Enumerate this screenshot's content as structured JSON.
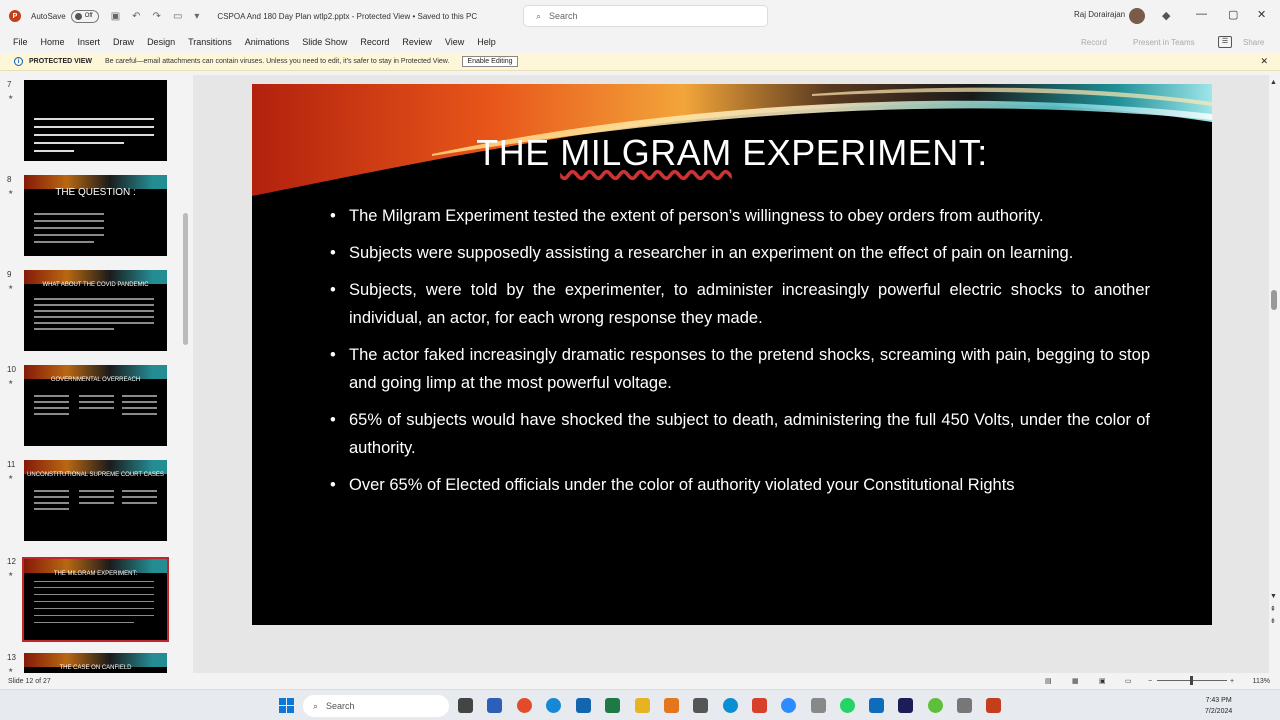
{
  "titlebar": {
    "autosave": "AutoSave",
    "toggle": "Off",
    "document": "CSPOA And 180 Day Plan wtlp2.pptx  -  Protected View  •  Saved to this PC",
    "search_placeholder": "Search",
    "user": "Raj Dorairajan"
  },
  "menu": {
    "items": [
      "File",
      "Home",
      "Insert",
      "Draw",
      "Design",
      "Transitions",
      "Animations",
      "Slide Show",
      "Record",
      "Review",
      "View",
      "Help"
    ],
    "record": "Record",
    "present": "Present in Teams",
    "share": "Share"
  },
  "protected_view": {
    "label": "PROTECTED VIEW",
    "message": "Be careful—email attachments can contain viruses. Unless you need to edit, it's safer to stay in Protected View.",
    "button": "Enable Editing"
  },
  "thumbnails": [
    {
      "num": "7",
      "title": ""
    },
    {
      "num": "8",
      "title": "THE QUESTION :"
    },
    {
      "num": "9",
      "title": "WHAT ABOUT THE COVID PANDEMIC"
    },
    {
      "num": "10",
      "title": "GOVERNMENTAL OVERREACH"
    },
    {
      "num": "11",
      "title": "UNCONSTITUTIONAL SUPREME COURT CASES"
    },
    {
      "num": "12",
      "title": "THE MILGRAM EXPERIMENT:"
    },
    {
      "num": "13",
      "title": "THE CASE ON CANFIELD"
    }
  ],
  "slide": {
    "title_pre": "THE ",
    "title_ul": "MILGRAM",
    "title_post": " EXPERIMENT:",
    "bullets": [
      "The Milgram Experiment tested the extent of person’s willingness to obey orders from authority.",
      "Subjects were supposedly assisting a researcher in an experiment on the effect of pain on learning.",
      "Subjects, were told by the experimenter, to administer increasingly powerful electric shocks to another individual, an actor, for each wrong response they made.",
      "The actor faked increasingly dramatic responses to the pretend shocks, screaming with pain, begging to stop and going limp at the most powerful voltage.",
      "65% of subjects would have shocked the subject to death, administering the full 450 Volts, under the color of authority.",
      "Over 65% of Elected officials under the color of authority violated your Constitutional Rights"
    ]
  },
  "status": {
    "slide_num": "Slide 12 of 27",
    "zoom": "113%"
  },
  "taskbar": {
    "search": "Search",
    "time": "7:43 PM",
    "date": "7/2/2024"
  },
  "colors": {
    "accent": "#c43e1c",
    "selected_border": "#c0272d",
    "slide_bg": "#000000"
  }
}
